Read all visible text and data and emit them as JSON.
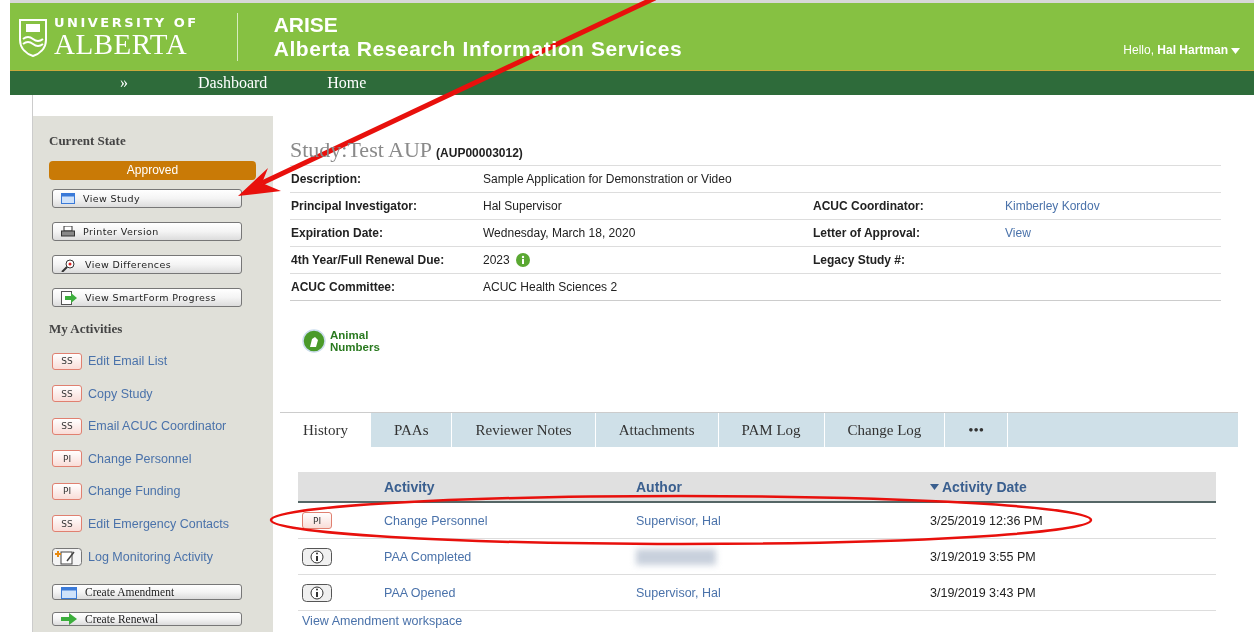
{
  "header": {
    "logo_top": "UNIVERSITY OF",
    "logo_bottom": "ALBERTA",
    "app_name": "ARISE",
    "app_full": "Alberta Research Information Services",
    "greeting": "Hello, **Hal Hartman**"
  },
  "nav": {
    "toggle": "»",
    "items": [
      "Dashboard",
      "Home"
    ]
  },
  "sidebar": {
    "state_heading": "Current State",
    "state": "Approved",
    "buttons": [
      {
        "label": "View Study"
      },
      {
        "label": "Printer Version"
      },
      {
        "label": "View Differences"
      },
      {
        "label": "View SmartForm Progress"
      }
    ],
    "activities_heading": "My Activities",
    "activities": [
      {
        "kind": "badge",
        "badge": "SS",
        "label": "Edit Email List"
      },
      {
        "kind": "badge",
        "badge": "SS",
        "label": "Copy Study"
      },
      {
        "kind": "badge",
        "badge": "SS",
        "label": "Email ACUC Coordinator"
      },
      {
        "kind": "badge",
        "badge": "PI",
        "label": "Change Personnel"
      },
      {
        "kind": "badge",
        "badge": "PI",
        "label": "Change Funding"
      },
      {
        "kind": "badge",
        "badge": "SS",
        "label": "Edit Emergency Contacts"
      },
      {
        "kind": "icon",
        "label": "Log Monitoring Activity"
      }
    ],
    "actions": [
      {
        "label": "Create Amendment"
      },
      {
        "label": "Create Renewal"
      }
    ]
  },
  "study": {
    "title": "Study:Test AUP",
    "code": "(AUP00003012)",
    "rows": [
      {
        "label": "Description:",
        "value": "Sample Application for Demonstration or Video",
        "info": false
      },
      {
        "label": "Principal Investigator:",
        "value": "Hal Supervisor",
        "info": false,
        "label2": "ACUC Coordinator:",
        "value2": "Kimberley Kordov"
      },
      {
        "label": "Expiration Date:",
        "value": "Wednesday, March 18, 2020",
        "info": false,
        "label2": "Letter of Approval:",
        "value2": "View"
      },
      {
        "label": "4th Year/Full Renewal Due:",
        "value": "2023",
        "info": true,
        "label2": "Legacy Study #:"
      },
      {
        "label": "ACUC Committee:",
        "value": "ACUC Health Sciences 2",
        "info": false
      }
    ],
    "animal_numbers": "Animal Numbers"
  },
  "tabs": [
    {
      "label": "History",
      "selected": true
    },
    {
      "label": "PAAs",
      "selected": false
    },
    {
      "label": "Reviewer Notes",
      "selected": false
    },
    {
      "label": "Attachments",
      "selected": false
    },
    {
      "label": "PAM Log",
      "selected": false
    },
    {
      "label": "Change Log",
      "selected": false
    },
    {
      "label": "•••",
      "selected": false
    }
  ],
  "history": {
    "columns": [
      {
        "label": "Activity",
        "sorted": false
      },
      {
        "label": "Author",
        "sorted": false
      },
      {
        "label": "Activity Date",
        "sorted": true
      }
    ],
    "rows": [
      {
        "kind": "badge",
        "badge": "PI",
        "activity": "Change Personnel",
        "author": "Supervisor, Hal",
        "redacted": false,
        "date": "3/25/2019 12:36 PM"
      },
      {
        "kind": "info",
        "activity": "PAA Completed",
        "redacted": true,
        "date": "3/19/2019 3:55 PM"
      },
      {
        "kind": "info",
        "activity": "PAA Opened",
        "author": "Supervisor, Hal",
        "redacted": false,
        "date": "3/19/2019 3:43 PM"
      }
    ],
    "link": "View Amendment workspace"
  }
}
